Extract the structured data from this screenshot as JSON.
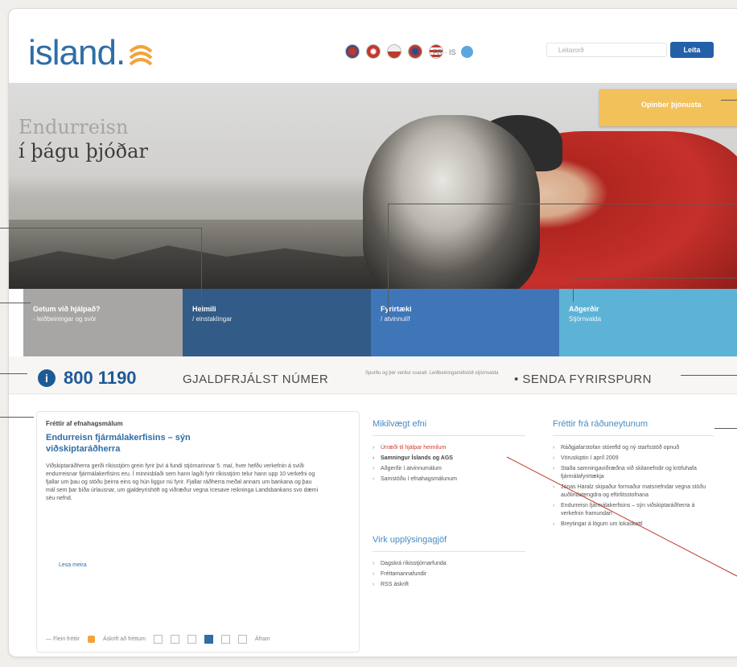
{
  "header": {
    "logo_text": "island.",
    "lang_links": "FR · IS",
    "search_placeholder": "Leitarorð",
    "search_button": "Leita"
  },
  "hero": {
    "title_line1": "Endurreisn",
    "title_line2": "í þágu þjóðar",
    "ops_button": "Opinber þjónusta"
  },
  "tiles": [
    {
      "title": "Getum við hjálpað?",
      "sub": "- leiðbeiningar og svör",
      "color": "#a7a6a4"
    },
    {
      "title": "Heimili",
      "sub": "/ einstaklingar",
      "color": "#325b87"
    },
    {
      "title": "Fyrirtæki",
      "sub": "/ atvinnulíf",
      "color": "#3f76b8"
    },
    {
      "title": "Aðgerðir",
      "sub": "Stjórnvalda",
      "color": "#5db3d6"
    }
  ],
  "phone": {
    "icon": "i",
    "number": "800 1190",
    "free_label": "GJALDFRJÁLST NÚMER",
    "small_text": "Spurðu og þér verður svarað. Leiðbeiningamiðstöð stjórnvalda",
    "send_label": "• SENDA FYRIRSPURN"
  },
  "news": {
    "label": "Fréttir af efnahagsmálum",
    "headline": "Endurreisn fjármálakerfisins – sýn viðskiptaráðherra",
    "body": "Viðskiptaráðherra gerði ríkisstjórn grein fyrir því á fundi stjórnarinnar 5. maí, hver hefðu verkefnin á sviði endurreisnar fjármálakerfisins eru. Í minnisblaði sem hann lagði fyrir ríkisstjórn telur hann upp 10 verkefni og fjallar um þau og stöðu þeirra eins og hún liggur nú fyrir. Fjallar ráðherra meðal annars um bankana og þau mál sem þar bíða úrlausnar, um gjaldeyrishöft og viðræður vegna Icesave reikninga Landsbankans svo dæmi séu nefnd.",
    "more": "Lesa meira",
    "older": "— Fleiri fréttir",
    "rss": "Áskrift að fréttum",
    "next": "Áfram"
  },
  "important": {
    "title": "Mikilvægt efni",
    "items": [
      "Úrræði til hjálpar heimilum",
      "Samningur Íslands og AGS",
      "Aðgerðir í atvinnumálum",
      "Samstöðu í efnahagsmálunum"
    ]
  },
  "info": {
    "title": "Virk upplýsingagjöf",
    "items": [
      "Dagskrá ríkisstjórnarfunda",
      "Fréttamannafundir",
      "RSS áskrift"
    ]
  },
  "ministry": {
    "title": "Fréttir frá ráðuneytunum",
    "items": [
      "Ráðgjafarstofan stórefld og ný starfsstöð opnuð",
      "Vöruskiptin í apríl 2009",
      "Staða samningaviðræðna við skilanefndir og kröfuhafa fjármálafyrirtækja",
      "Jónas Haralz skipaður formaður matsnefndar vegna stöðu auðlindatengdra og eftirlitsstofnana",
      "Endurreisn fjármálakerfisins – sýn viðskiptaráðherra á verkefnin framundan",
      "Breytingar á lögum um lokaskattl"
    ]
  }
}
